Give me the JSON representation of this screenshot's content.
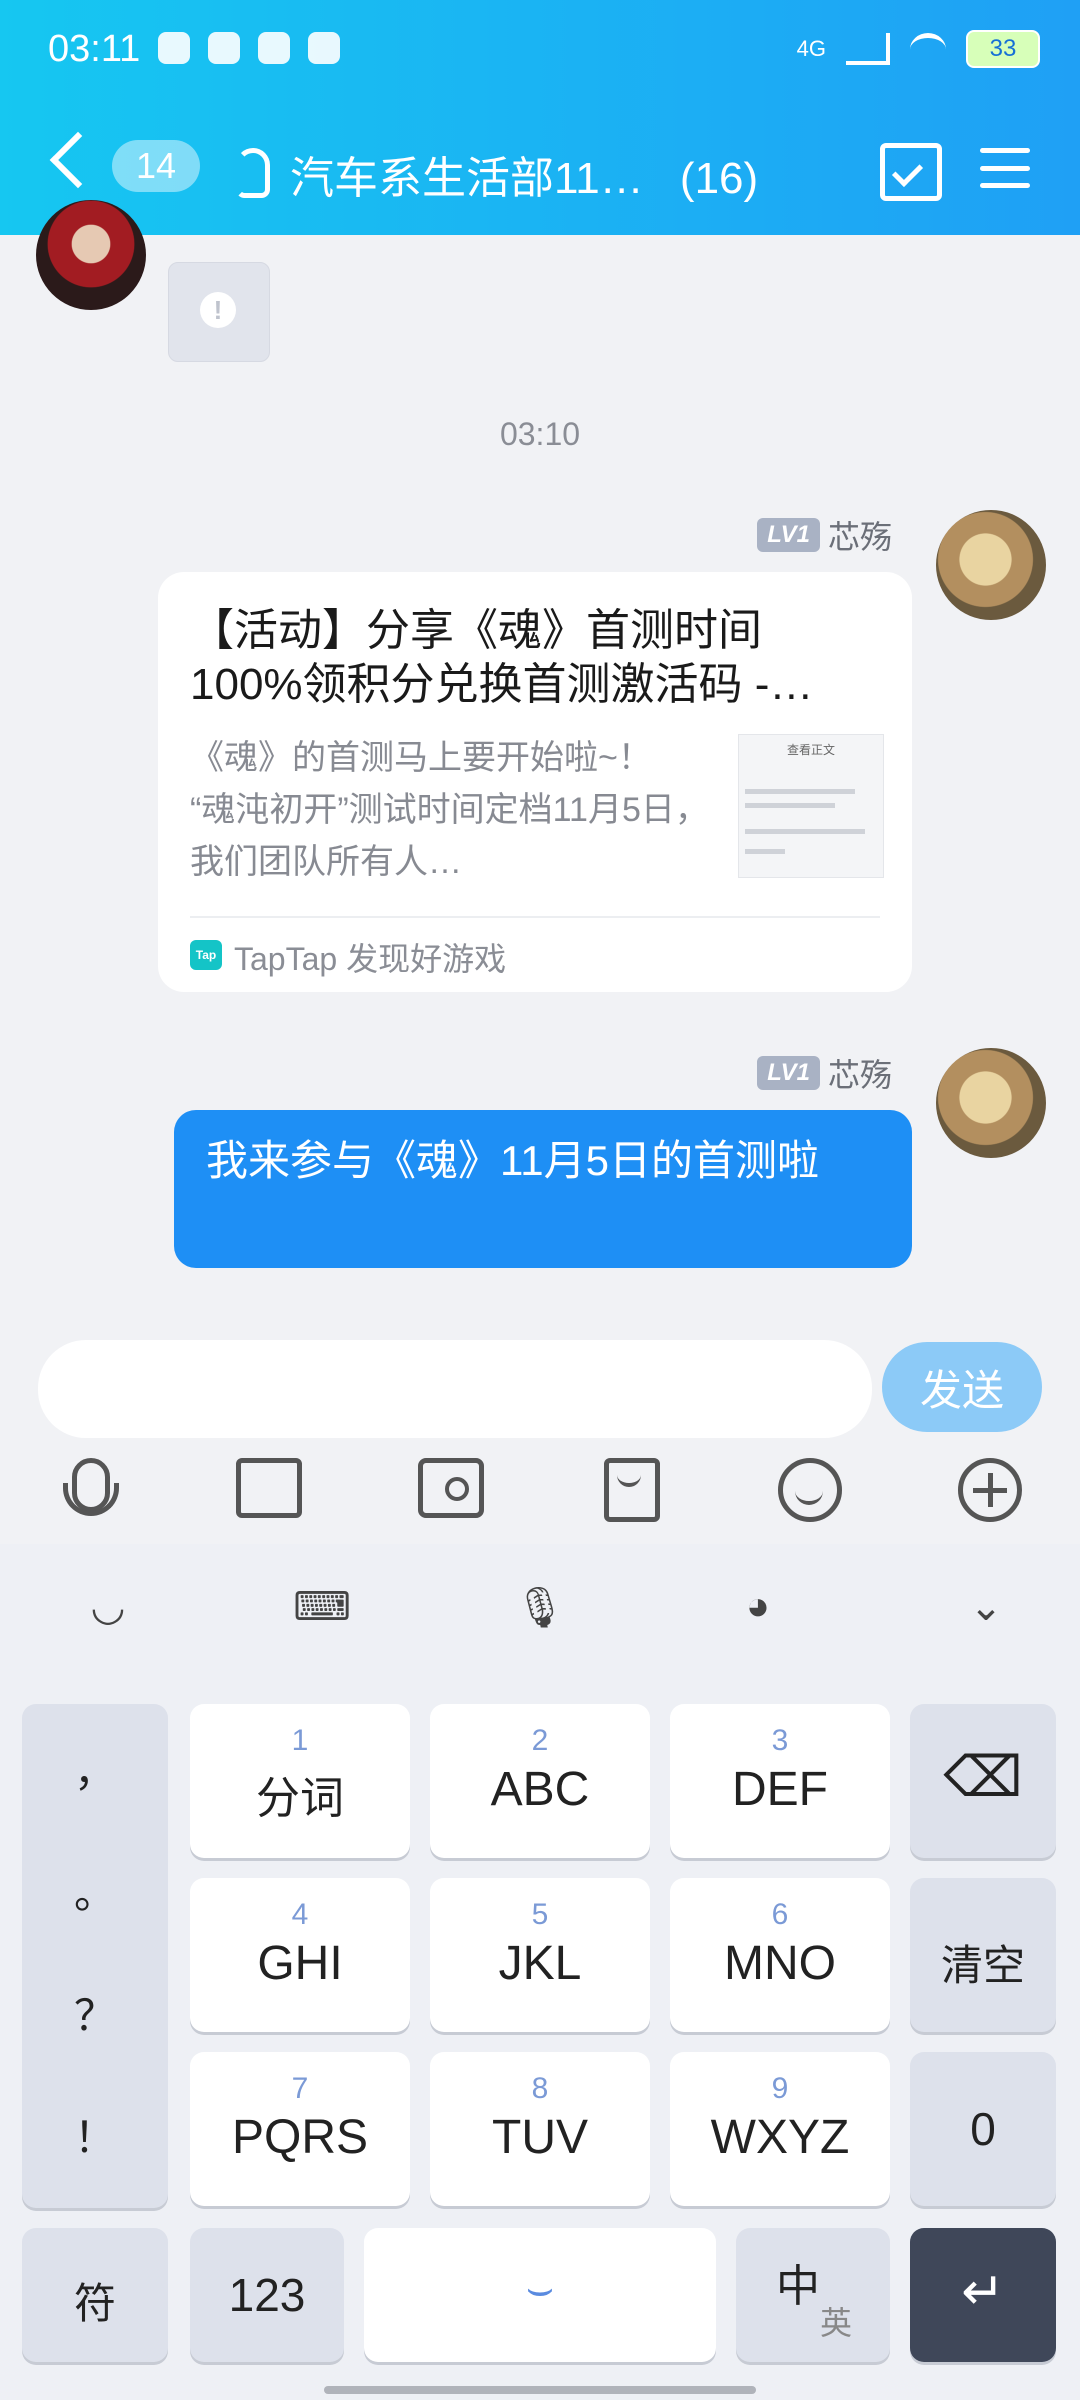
{
  "status_bar": {
    "time": "03:11",
    "network": "4G",
    "battery": "33"
  },
  "header": {
    "unread_count": "14",
    "title": "汽车系生活部11…",
    "member_count": "(16)"
  },
  "chat": {
    "timestamp": "03:10",
    "messages": [
      {
        "sender_level": "LV1",
        "sender_name": "芯殇",
        "type": "link_card",
        "title": "【活动】分享《魂》首测时间100%领积分兑换首测激活码 -…",
        "description": "《魂》的首测马上要开始啦~！\n“魂沌初开”测试时间定档11月5日，我们团队所有人…",
        "thumb_title": "查看正文",
        "source_logo": "Tap",
        "source": "TapTap 发现好游戏"
      },
      {
        "sender_level": "LV1",
        "sender_name": "芯殇",
        "type": "text",
        "text": "我来参与《魂》11月5日的首测啦"
      }
    ]
  },
  "composer": {
    "send_label": "发送",
    "input_value": ""
  },
  "keyboard": {
    "punctuation": [
      "，",
      "。",
      "？",
      "！"
    ],
    "keys": [
      {
        "num": "1",
        "label": "分词"
      },
      {
        "num": "2",
        "label": "ABC"
      },
      {
        "num": "3",
        "label": "DEF"
      },
      {
        "num": "4",
        "label": "GHI"
      },
      {
        "num": "5",
        "label": "JKL"
      },
      {
        "num": "6",
        "label": "MNO"
      },
      {
        "num": "7",
        "label": "PQRS"
      },
      {
        "num": "8",
        "label": "TUV"
      },
      {
        "num": "9",
        "label": "WXYZ"
      }
    ],
    "clear_label": "清空",
    "zero_label": "0",
    "symbol_label": "符",
    "num_label": "123",
    "lang_main": "中",
    "lang_alt": "英"
  },
  "colors": {
    "header_start": "#16c7f1",
    "header_end": "#1fa0f5",
    "bubble": "#1e8ff5",
    "send_button": "#8ccaf7"
  }
}
